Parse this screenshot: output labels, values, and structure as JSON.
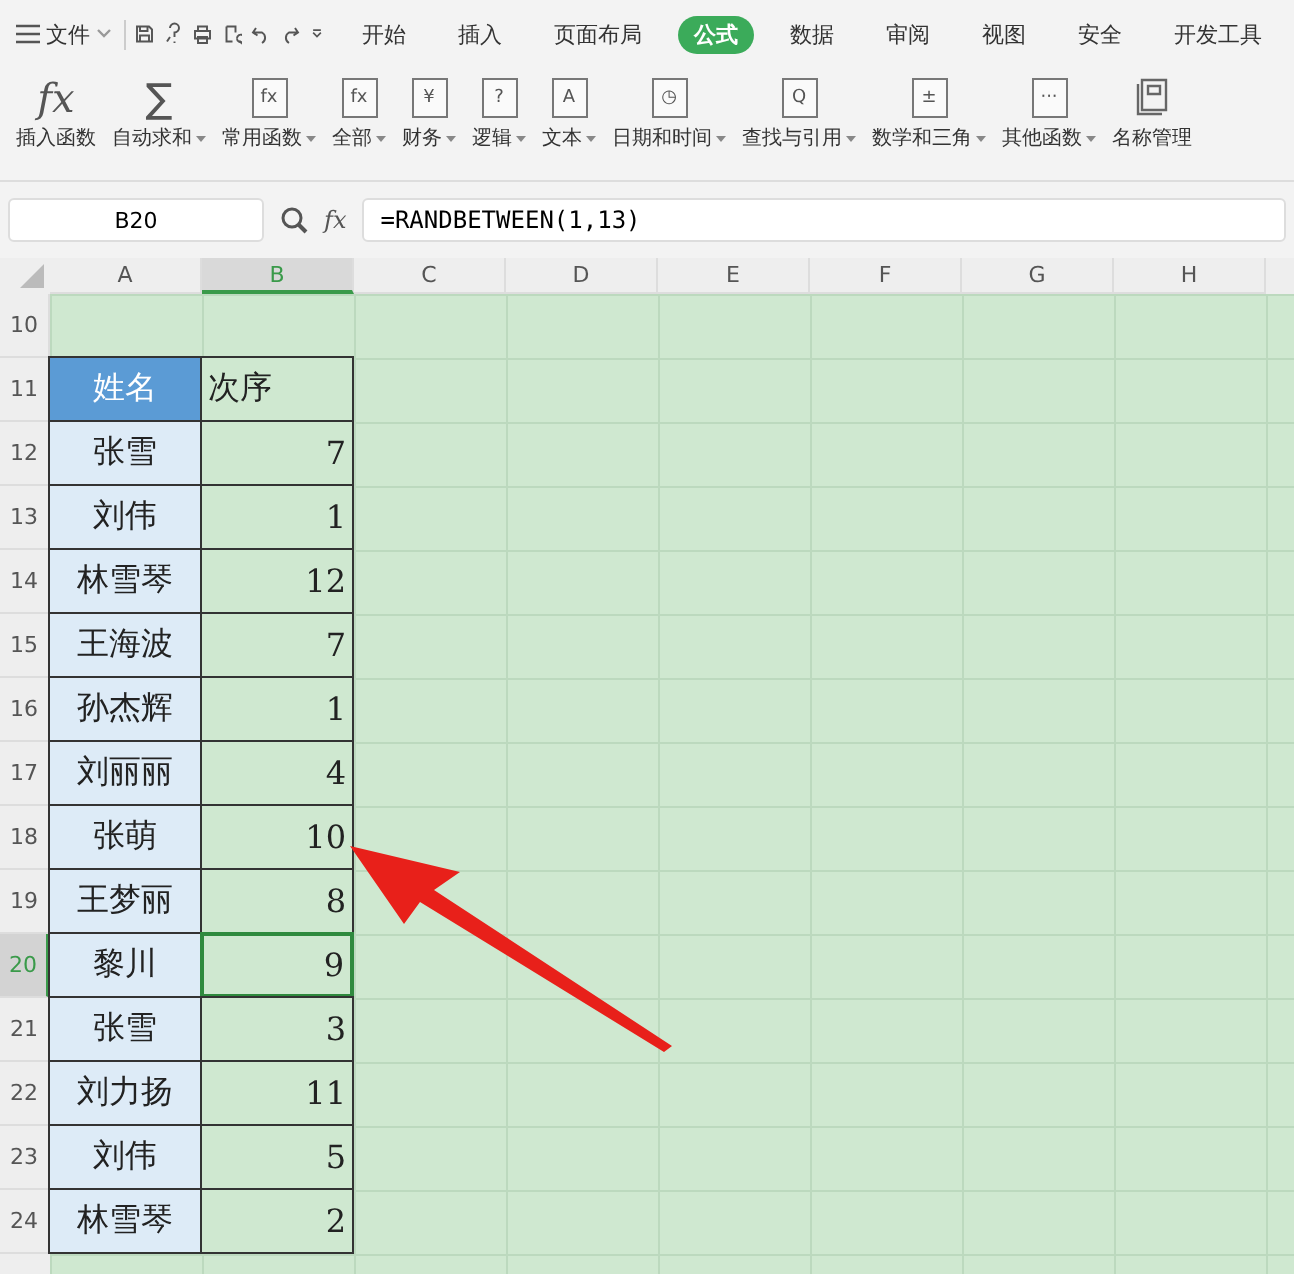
{
  "menu": {
    "file": "文件",
    "tabs": [
      {
        "label": "开始",
        "selected": false
      },
      {
        "label": "插入",
        "selected": false
      },
      {
        "label": "页面布局",
        "selected": false
      },
      {
        "label": "公式",
        "selected": true
      },
      {
        "label": "数据",
        "selected": false
      },
      {
        "label": "审阅",
        "selected": false
      },
      {
        "label": "视图",
        "selected": false
      },
      {
        "label": "安全",
        "selected": false
      },
      {
        "label": "开发工具",
        "selected": false
      }
    ]
  },
  "ribbon": [
    {
      "label": "插入函数",
      "dropdown": false,
      "glyph": "fx"
    },
    {
      "label": "自动求和",
      "dropdown": true,
      "glyph": "∑"
    },
    {
      "label": "常用函数",
      "dropdown": true,
      "glyph": "fx"
    },
    {
      "label": "全部",
      "dropdown": true,
      "glyph": "fx"
    },
    {
      "label": "财务",
      "dropdown": true,
      "glyph": "¥"
    },
    {
      "label": "逻辑",
      "dropdown": true,
      "glyph": "?"
    },
    {
      "label": "文本",
      "dropdown": true,
      "glyph": "A"
    },
    {
      "label": "日期和时间",
      "dropdown": true,
      "glyph": "◷"
    },
    {
      "label": "查找与引用",
      "dropdown": true,
      "glyph": "Q"
    },
    {
      "label": "数学和三角",
      "dropdown": true,
      "glyph": "±"
    },
    {
      "label": "其他函数",
      "dropdown": true,
      "glyph": "···"
    },
    {
      "label": "名称管理",
      "dropdown": false
    }
  ],
  "formula_bar": {
    "cell": "B20",
    "fx": "fx",
    "formula": "=RANDBETWEEN(1,13)"
  },
  "columns": [
    {
      "label": "A",
      "selected": false
    },
    {
      "label": "B",
      "selected": true
    },
    {
      "label": "C",
      "selected": false
    },
    {
      "label": "D",
      "selected": false
    },
    {
      "label": "E",
      "selected": false
    },
    {
      "label": "F",
      "selected": false
    },
    {
      "label": "G",
      "selected": false
    },
    {
      "label": "H",
      "selected": false
    }
  ],
  "rows": [
    {
      "number": "10",
      "kind": "empty",
      "selected": false
    },
    {
      "number": "11",
      "kind": "header",
      "name": "姓名",
      "value": "次序",
      "selected": false
    },
    {
      "number": "12",
      "kind": "data",
      "name": "张雪",
      "value": "7",
      "selected": false
    },
    {
      "number": "13",
      "kind": "data",
      "name": "刘伟",
      "value": "1",
      "selected": false
    },
    {
      "number": "14",
      "kind": "data",
      "name": "林雪琴",
      "value": "12",
      "selected": false
    },
    {
      "number": "15",
      "kind": "data",
      "name": "王海波",
      "value": "7",
      "selected": false
    },
    {
      "number": "16",
      "kind": "data",
      "name": "孙杰辉",
      "value": "1",
      "selected": false
    },
    {
      "number": "17",
      "kind": "data",
      "name": "刘丽丽",
      "value": "4",
      "selected": false
    },
    {
      "number": "18",
      "kind": "data",
      "name": "张萌",
      "value": "10",
      "selected": false
    },
    {
      "number": "19",
      "kind": "data",
      "name": "王梦丽",
      "value": "8",
      "selected": false
    },
    {
      "number": "20",
      "kind": "data",
      "name": "黎川",
      "value": "9",
      "selected": true
    },
    {
      "number": "21",
      "kind": "data",
      "name": "张雪",
      "value": "3",
      "selected": false
    },
    {
      "number": "22",
      "kind": "data",
      "name": "刘力扬",
      "value": "11",
      "selected": false
    },
    {
      "number": "23",
      "kind": "data",
      "name": "刘伟",
      "value": "5",
      "selected": false
    },
    {
      "number": "24",
      "kind": "data",
      "name": "林雪琴",
      "value": "2",
      "selected": false
    }
  ]
}
